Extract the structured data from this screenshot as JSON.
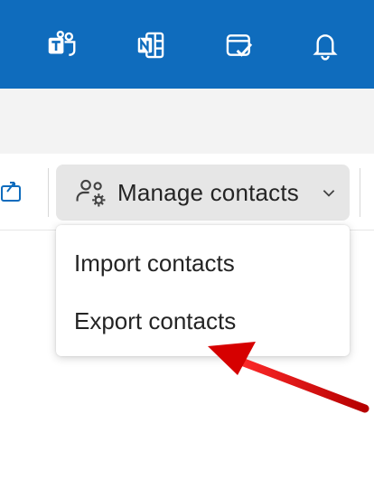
{
  "topbar": {
    "icons": [
      "teams-icon",
      "onenote-icon",
      "todo-icon",
      "bell-icon"
    ],
    "accent": "#0f6cbd"
  },
  "ribbon": {
    "manage_contacts_label": "Manage contacts"
  },
  "menu": {
    "items": [
      {
        "label": "Import contacts"
      },
      {
        "label": "Export contacts"
      }
    ]
  },
  "annotation": {
    "arrow_color": "#cc0000"
  }
}
